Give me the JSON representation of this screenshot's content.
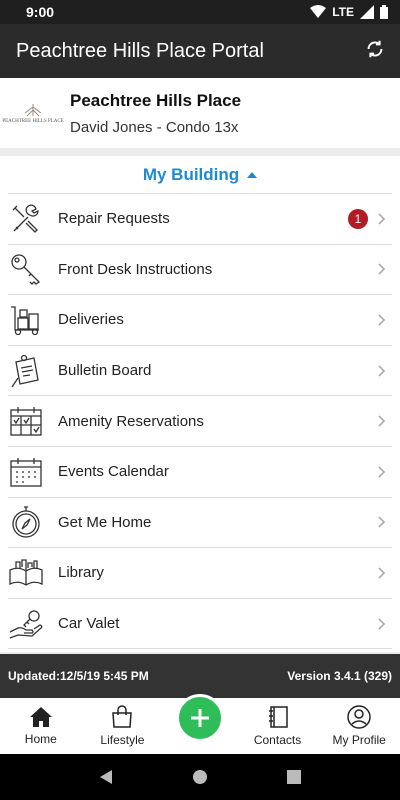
{
  "status_bar": {
    "time": "9:00",
    "network": "LTE"
  },
  "app_bar": {
    "title": "Peachtree Hills Place Portal",
    "action_icon": "refresh-icon"
  },
  "header": {
    "logo_text": "PEACHTREE HILLS PLACE",
    "name": "Peachtree Hills Place",
    "subtitle": "David Jones - Condo 13x"
  },
  "section": {
    "title": "My Building"
  },
  "menu": [
    {
      "label": "Repair Requests",
      "icon": "tools-icon",
      "badge": "1"
    },
    {
      "label": "Front Desk Instructions",
      "icon": "key-icon"
    },
    {
      "label": "Deliveries",
      "icon": "dolly-icon"
    },
    {
      "label": "Bulletin Board",
      "icon": "note-icon"
    },
    {
      "label": "Amenity Reservations",
      "icon": "calendar-check-icon"
    },
    {
      "label": "Events Calendar",
      "icon": "calendar-icon"
    },
    {
      "label": "Get Me Home",
      "icon": "compass-icon"
    },
    {
      "label": "Library",
      "icon": "book-icon"
    },
    {
      "label": "Car Valet",
      "icon": "car-key-icon"
    }
  ],
  "footer": {
    "updated": "Updated:12/5/19 5:45 PM",
    "version": "Version 3.4.1 (329)"
  },
  "bottom_nav": {
    "home": "Home",
    "lifestyle": "Lifestyle",
    "contacts": "Contacts",
    "profile": "My Profile"
  },
  "colors": {
    "accent": "#1f8ad1",
    "fab": "#2ebd59",
    "badge": "#b11d26"
  }
}
